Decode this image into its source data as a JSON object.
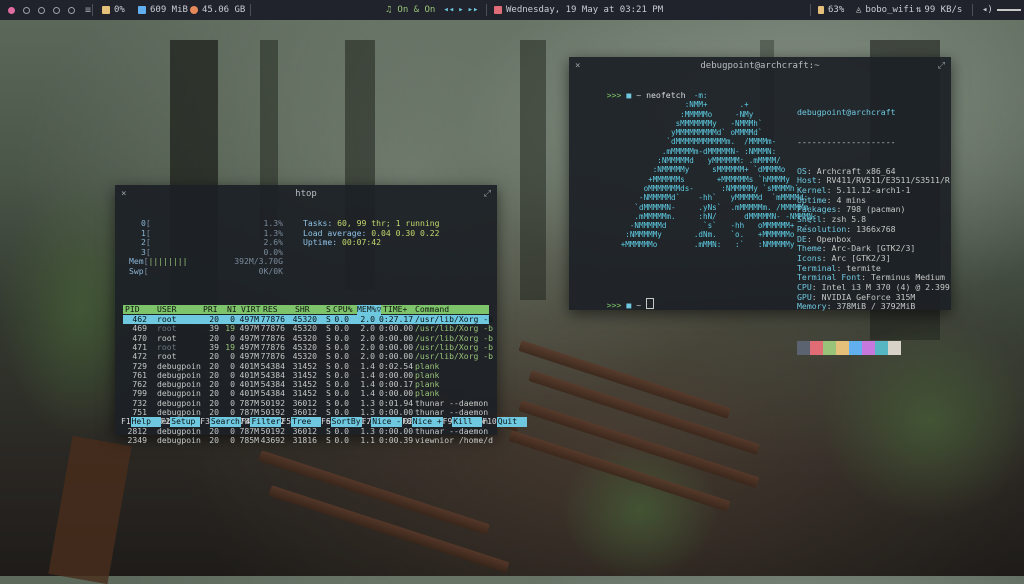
{
  "topbar": {
    "workspaces": [
      true,
      false,
      false,
      false,
      false
    ],
    "menu_icon": "hamburger-icon",
    "cpu": "0%",
    "ram": "609 MiB",
    "disk": "45.06 GB",
    "music": "On & On",
    "date": "Wednesday, 19 May at 03:21 PM",
    "battery": "63%",
    "wifi": "bobo_wifi",
    "net_speed": "99 KB/s",
    "colors": {
      "accent": "#e06ca1",
      "bar_bg": "#20232b"
    }
  },
  "htop": {
    "title": "htop",
    "cpus": [
      {
        "label": "0",
        "value": "1.3%"
      },
      {
        "label": "1",
        "value": "1.3%"
      },
      {
        "label": "2",
        "value": "2.6%"
      },
      {
        "label": "3",
        "value": "0.0%"
      }
    ],
    "mem": {
      "label": "Mem",
      "bar": "||||||||",
      "value": "392M/3.70G"
    },
    "swap": {
      "label": "Swp",
      "value": "0K/0K"
    },
    "tasks_key": "Tasks:",
    "tasks_val": "60, 99 thr; 1 running",
    "load_key": "Load average:",
    "load_val": "0.04 0.30 0.22",
    "uptime_key": "Uptime:",
    "uptime_val": "00:07:42",
    "columns": [
      "PID",
      "USER",
      "PRI",
      "NI",
      "VIRT",
      "RES",
      "SHR",
      "S",
      "CPU%",
      "MEM%▽",
      "TIME+",
      "Command"
    ],
    "rows": [
      [
        "462",
        "root",
        "20",
        "0",
        "497M",
        "77876",
        "45320",
        "S",
        "0.0",
        "2.0",
        "0:27.17",
        "/usr/lib/Xorg -b"
      ],
      [
        "469",
        "root",
        "39",
        "19",
        "497M",
        "77876",
        "45320",
        "S",
        "0.0",
        "2.0",
        "0:00.00",
        "/usr/lib/Xorg -b"
      ],
      [
        "470",
        "root",
        "20",
        "0",
        "497M",
        "77876",
        "45320",
        "S",
        "0.0",
        "2.0",
        "0:00.00",
        "/usr/lib/Xorg -b"
      ],
      [
        "471",
        "root",
        "39",
        "19",
        "497M",
        "77876",
        "45320",
        "S",
        "0.0",
        "2.0",
        "0:00.00",
        "/usr/lib/Xorg -b"
      ],
      [
        "472",
        "root",
        "20",
        "0",
        "497M",
        "77876",
        "45320",
        "S",
        "0.0",
        "2.0",
        "0:00.00",
        "/usr/lib/Xorg -b"
      ],
      [
        "729",
        "debugpoin",
        "20",
        "0",
        "401M",
        "54384",
        "31452",
        "S",
        "0.0",
        "1.4",
        "0:02.54",
        "plank"
      ],
      [
        "761",
        "debugpoin",
        "20",
        "0",
        "401M",
        "54384",
        "31452",
        "S",
        "0.0",
        "1.4",
        "0:00.00",
        "plank"
      ],
      [
        "762",
        "debugpoin",
        "20",
        "0",
        "401M",
        "54384",
        "31452",
        "S",
        "0.0",
        "1.4",
        "0:00.17",
        "plank"
      ],
      [
        "799",
        "debugpoin",
        "20",
        "0",
        "401M",
        "54384",
        "31452",
        "S",
        "0.0",
        "1.4",
        "0:00.00",
        "plank"
      ],
      [
        "732",
        "debugpoin",
        "20",
        "0",
        "787M",
        "50192",
        "36012",
        "S",
        "0.0",
        "1.3",
        "0:01.94",
        "thunar --daemon"
      ],
      [
        "751",
        "debugpoin",
        "20",
        "0",
        "787M",
        "50192",
        "36012",
        "S",
        "0.0",
        "1.3",
        "0:00.00",
        "thunar --daemon"
      ],
      [
        "752",
        "debugpoin",
        "20",
        "0",
        "787M",
        "50192",
        "36012",
        "S",
        "0.0",
        "1.3",
        "0:00.02",
        "thunar --daemon"
      ],
      [
        "2812",
        "debugpoin",
        "20",
        "0",
        "787M",
        "50192",
        "36012",
        "S",
        "0.0",
        "1.3",
        "0:00.00",
        "thunar --daemon"
      ],
      [
        "2349",
        "debugpoin",
        "20",
        "0",
        "785M",
        "43692",
        "31816",
        "S",
        "0.0",
        "1.1",
        "0:00.39",
        "viewnior /home/d"
      ]
    ],
    "fkeys": [
      {
        "n": "F1",
        "l": "Help"
      },
      {
        "n": "F2",
        "l": "Setup"
      },
      {
        "n": "F3",
        "l": "Search"
      },
      {
        "n": "F4",
        "l": "Filter"
      },
      {
        "n": "F5",
        "l": "Tree"
      },
      {
        "n": "F6",
        "l": "SortBy"
      },
      {
        "n": "F7",
        "l": "Nice -"
      },
      {
        "n": "F8",
        "l": "Nice +"
      },
      {
        "n": "F9",
        "l": "Kill"
      },
      {
        "n": "F10",
        "l": "Quit"
      }
    ]
  },
  "neofetch": {
    "title": "debugpoint@archcraft:~",
    "prompt": ">>>",
    "command": "neofetch",
    "art": [
      "                   -m:",
      "                 :NMM+       .+",
      "                :MMMMMo     -NMy",
      "               sMMMMMMMy   -NMMMh`",
      "              yMMMMMMMMMd` oMMMMd`",
      "             `dMMMMMMMMMMMm.  /MMMMm-",
      "            .mMMMMMm-dMMMMMN- :NMMMN:",
      "           :NMMMMMd   yMMMMMM: .mMMMM/",
      "          :NMMMMMy     sMMMMMM+ `dMMMMo",
      "         +MMMMMMs       +MMMMMMs `hMMMMy",
      "        oMMMMMMMds-      :NMMMMMy `sMMMMh`",
      "       -NMMMMMd`    -hh`   yMMMMMd  `mMMMMd:",
      "      `dMMMMMN-     .yNs`  .mMMMMMm. /MMMMMm.",
      "      .mMMMMMm.     :hN/      dMMMMMN- -NMMMN:",
      "     -NMMMMMd        `s`   -hh   oMMMMMM+ .-`",
      "    :NMMMMMy       .dNm.   `o.   +MMMMMMo",
      "   +MMMMMMo        .mMMN:   :`   :NMMMMMy"
    ],
    "user_host": "debugpoint@archcraft",
    "separator": "--------------------",
    "info": [
      {
        "k": "OS",
        "v": "Archcraft x86_64"
      },
      {
        "k": "Host",
        "v": "RV411/RV511/E3511/S3511/R"
      },
      {
        "k": "Kernel",
        "v": "5.11.12-arch1-1"
      },
      {
        "k": "Uptime",
        "v": "4 mins"
      },
      {
        "k": "Packages",
        "v": "798 (pacman)"
      },
      {
        "k": "Shell",
        "v": "zsh 5.8"
      },
      {
        "k": "Resolution",
        "v": "1366x768"
      },
      {
        "k": "DE",
        "v": "Openbox"
      },
      {
        "k": "Theme",
        "v": "Arc-Dark [GTK2/3]"
      },
      {
        "k": "Icons",
        "v": "Arc [GTK2/3]"
      },
      {
        "k": "Terminal",
        "v": "termite"
      },
      {
        "k": "Terminal Font",
        "v": "Terminus Medium"
      },
      {
        "k": "CPU",
        "v": "Intel i3 M 370 (4) @ 2.399"
      },
      {
        "k": "GPU",
        "v": "NVIDIA GeForce 315M"
      },
      {
        "k": "Memory",
        "v": "378MiB / 3792MiB"
      }
    ],
    "palette": [
      "#5c6370",
      "#e06c75",
      "#98c379",
      "#e5c07b",
      "#61afef",
      "#c678dd",
      "#56b6c2",
      "#d8d3c8"
    ]
  }
}
